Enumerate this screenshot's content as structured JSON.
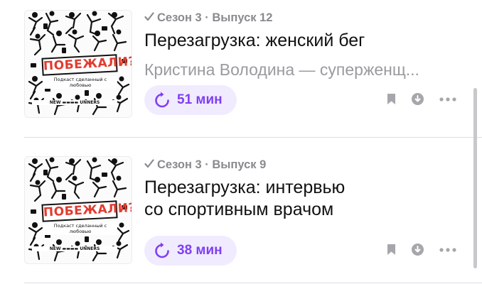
{
  "episodes": [
    {
      "meta": "Сезон 3 · Выпуск 12",
      "title_lines": [
        "Перезагрузка: женский бег"
      ],
      "subtitle": "Кристина Володина — суперженщ...",
      "duration": "51 мин",
      "cover": {
        "title": "ПОБЕЖАЛИ?!",
        "subtitle": "Подкаст сделанный с любовью",
        "brand": "NEW ▬▬▬▬ UNNERS"
      }
    },
    {
      "meta": "Сезон 3 · Выпуск 9",
      "title_lines": [
        "Перезагрузка: интервью",
        "со спортивным врачом"
      ],
      "subtitle": "",
      "duration": "38 мин",
      "cover": {
        "title": "ПОБЕЖАЛИ?!",
        "subtitle": "Подкаст сделанный с любовью",
        "brand": "NEW ▬▬▬▬ UNNERS"
      }
    }
  ],
  "icons": {
    "played": "checkmark-icon",
    "duration": "replay-icon",
    "save": "bookmark-icon",
    "download": "download-icon",
    "more": "more-icon"
  },
  "colors": {
    "accent": "#7e3ff2",
    "accent_bg": "#f1ebff",
    "cover_title": "#e23b2f",
    "secondary_text": "#8a8a8f",
    "icon_gray": "#a6a6ab"
  }
}
